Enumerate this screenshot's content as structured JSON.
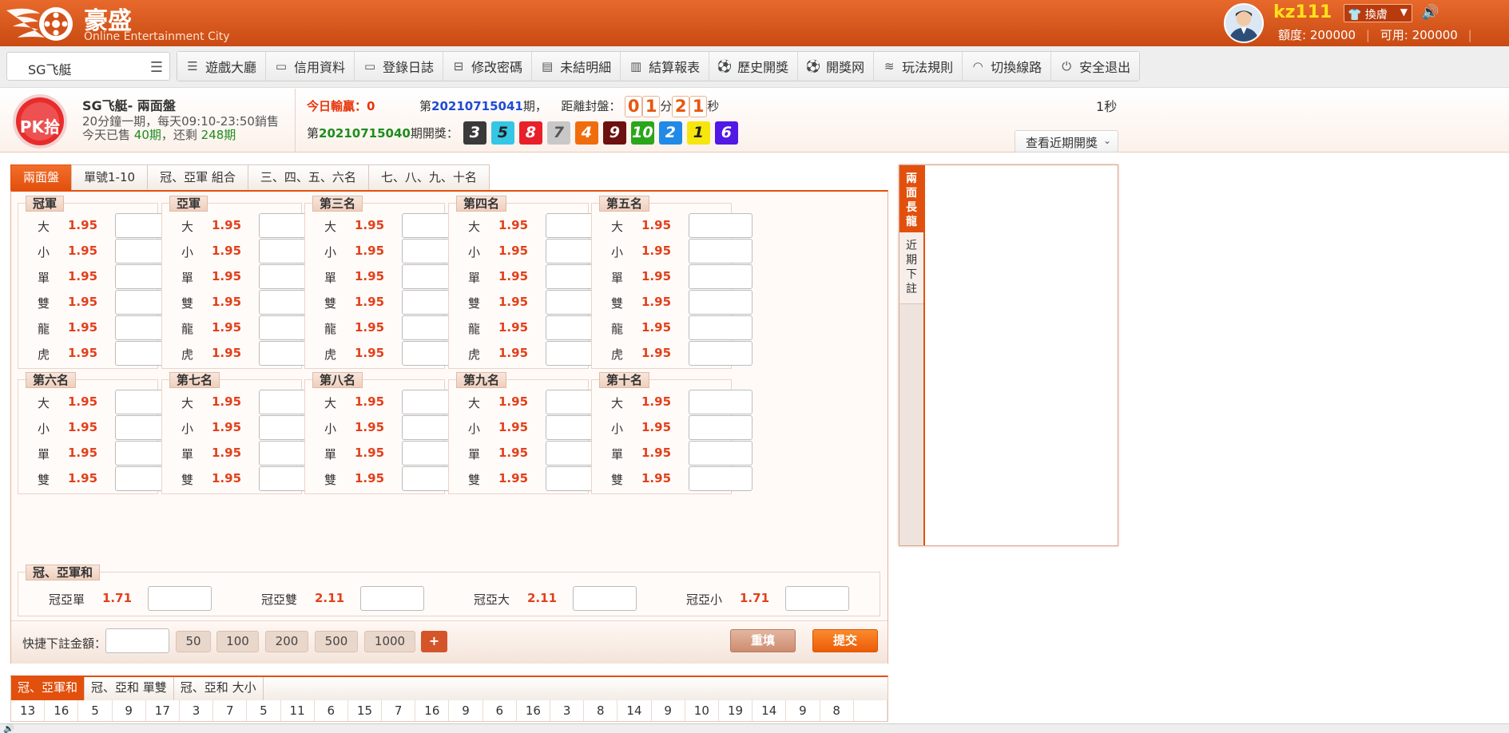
{
  "header": {
    "brand": "豪盛",
    "brand_sub": "Online Entertainment City",
    "username": "kz111",
    "skin_label": "換膚",
    "quota_label": "額度:",
    "quota_value": "200000",
    "available_label": "可用:",
    "available_value": "200000",
    "sep": "|"
  },
  "nav": {
    "game_select": "SG飞艇",
    "items": [
      {
        "label": "遊戲大廳"
      },
      {
        "label": "信用資料"
      },
      {
        "label": "登錄日誌"
      },
      {
        "label": "修改密碼"
      },
      {
        "label": "未結明細"
      },
      {
        "label": "結算報表"
      },
      {
        "label": "歷史開獎"
      },
      {
        "label": "開獎网"
      },
      {
        "label": "玩法規則"
      },
      {
        "label": "切換線路"
      },
      {
        "label": "安全退出"
      }
    ]
  },
  "info": {
    "logo_text": "PK拾",
    "game_title": "SG飞艇- 兩面盤",
    "desc_line1": "20分鐘一期，每天09:10-23:50銷售",
    "sold_prefix": "今天已售 ",
    "sold_count": "40期",
    "remain_mid": "，还剩 ",
    "remain_count": "248期",
    "today_label": "今日輸贏：",
    "today_value": "0",
    "period_prefix": "第",
    "current_period": "20210715041",
    "period_suffix": "期，",
    "countdown_label": "距離封盤：",
    "cd_m1": "0",
    "cd_m2": "1",
    "cd_min_unit": "分",
    "cd_s1": "2",
    "cd_s2": "1",
    "cd_sec_unit": "秒",
    "refresh_num": "1",
    "refresh_unit": "秒",
    "last_prefix": "第",
    "last_period": "20210715040",
    "last_suffix": "期開獎：",
    "balls": [
      {
        "n": "3",
        "color": "#3a3a3a"
      },
      {
        "n": "5",
        "color": "#35c6e6"
      },
      {
        "n": "8",
        "color": "#e8202a"
      },
      {
        "n": "7",
        "color": "#c8c8c8"
      },
      {
        "n": "4",
        "color": "#f06d0d"
      },
      {
        "n": "9",
        "color": "#6d1010"
      },
      {
        "n": "10",
        "color": "#2aa61a"
      },
      {
        "n": "2",
        "color": "#2189e6"
      },
      {
        "n": "1",
        "color": "#f6e60d"
      },
      {
        "n": "6",
        "color": "#5118e6"
      }
    ],
    "view_recent": "查看近期開獎"
  },
  "tabs": [
    {
      "label": "兩面盤"
    },
    {
      "label": "單號1-10"
    },
    {
      "label": "冠、亞軍 組合"
    },
    {
      "label": "三、四、五、六名"
    },
    {
      "label": "七、八、九、十名"
    }
  ],
  "positions": [
    {
      "title": "冠軍",
      "opts": [
        {
          "label": "大",
          "odds": "1.95"
        },
        {
          "label": "小",
          "odds": "1.95"
        },
        {
          "label": "單",
          "odds": "1.95"
        },
        {
          "label": "雙",
          "odds": "1.95"
        },
        {
          "label": "龍",
          "odds": "1.95"
        },
        {
          "label": "虎",
          "odds": "1.95"
        }
      ]
    },
    {
      "title": "亞軍",
      "opts": [
        {
          "label": "大",
          "odds": "1.95"
        },
        {
          "label": "小",
          "odds": "1.95"
        },
        {
          "label": "單",
          "odds": "1.95"
        },
        {
          "label": "雙",
          "odds": "1.95"
        },
        {
          "label": "龍",
          "odds": "1.95"
        },
        {
          "label": "虎",
          "odds": "1.95"
        }
      ]
    },
    {
      "title": "第三名",
      "opts": [
        {
          "label": "大",
          "odds": "1.95"
        },
        {
          "label": "小",
          "odds": "1.95"
        },
        {
          "label": "單",
          "odds": "1.95"
        },
        {
          "label": "雙",
          "odds": "1.95"
        },
        {
          "label": "龍",
          "odds": "1.95"
        },
        {
          "label": "虎",
          "odds": "1.95"
        }
      ]
    },
    {
      "title": "第四名",
      "opts": [
        {
          "label": "大",
          "odds": "1.95"
        },
        {
          "label": "小",
          "odds": "1.95"
        },
        {
          "label": "單",
          "odds": "1.95"
        },
        {
          "label": "雙",
          "odds": "1.95"
        },
        {
          "label": "龍",
          "odds": "1.95"
        },
        {
          "label": "虎",
          "odds": "1.95"
        }
      ]
    },
    {
      "title": "第五名",
      "opts": [
        {
          "label": "大",
          "odds": "1.95"
        },
        {
          "label": "小",
          "odds": "1.95"
        },
        {
          "label": "單",
          "odds": "1.95"
        },
        {
          "label": "雙",
          "odds": "1.95"
        },
        {
          "label": "龍",
          "odds": "1.95"
        },
        {
          "label": "虎",
          "odds": "1.95"
        }
      ]
    },
    {
      "title": "第六名",
      "opts": [
        {
          "label": "大",
          "odds": "1.95"
        },
        {
          "label": "小",
          "odds": "1.95"
        },
        {
          "label": "單",
          "odds": "1.95"
        },
        {
          "label": "雙",
          "odds": "1.95"
        }
      ]
    },
    {
      "title": "第七名",
      "opts": [
        {
          "label": "大",
          "odds": "1.95"
        },
        {
          "label": "小",
          "odds": "1.95"
        },
        {
          "label": "單",
          "odds": "1.95"
        },
        {
          "label": "雙",
          "odds": "1.95"
        }
      ]
    },
    {
      "title": "第八名",
      "opts": [
        {
          "label": "大",
          "odds": "1.95"
        },
        {
          "label": "小",
          "odds": "1.95"
        },
        {
          "label": "單",
          "odds": "1.95"
        },
        {
          "label": "雙",
          "odds": "1.95"
        }
      ]
    },
    {
      "title": "第九名",
      "opts": [
        {
          "label": "大",
          "odds": "1.95"
        },
        {
          "label": "小",
          "odds": "1.95"
        },
        {
          "label": "單",
          "odds": "1.95"
        },
        {
          "label": "雙",
          "odds": "1.95"
        }
      ]
    },
    {
      "title": "第十名",
      "opts": [
        {
          "label": "大",
          "odds": "1.95"
        },
        {
          "label": "小",
          "odds": "1.95"
        },
        {
          "label": "單",
          "odds": "1.95"
        },
        {
          "label": "雙",
          "odds": "1.95"
        }
      ]
    }
  ],
  "pair": {
    "title": "冠、亞軍和",
    "opts": [
      {
        "label": "冠亞單",
        "odds": "1.71"
      },
      {
        "label": "冠亞雙",
        "odds": "2.11"
      },
      {
        "label": "冠亞大",
        "odds": "2.11"
      },
      {
        "label": "冠亞小",
        "odds": "1.71"
      }
    ]
  },
  "quick": {
    "label": "快捷下註金額：",
    "chips": [
      "50",
      "100",
      "200",
      "500",
      "1000"
    ],
    "plus": "+",
    "reset": "重填",
    "submit": "提交"
  },
  "side": {
    "tab1": "兩面長龍",
    "tab2": "近期下註"
  },
  "bottom": {
    "tabs": [
      {
        "label": "冠、亞軍和"
      },
      {
        "label": "冠、亞和 單雙"
      },
      {
        "label": "冠、亞和 大小"
      }
    ],
    "values": [
      "13",
      "16",
      "5",
      "9",
      "17",
      "3",
      "7",
      "5",
      "11",
      "6",
      "15",
      "7",
      "16",
      "9",
      "6",
      "16",
      "3",
      "8",
      "14",
      "9",
      "10",
      "19",
      "14",
      "9",
      "8",
      ""
    ]
  }
}
